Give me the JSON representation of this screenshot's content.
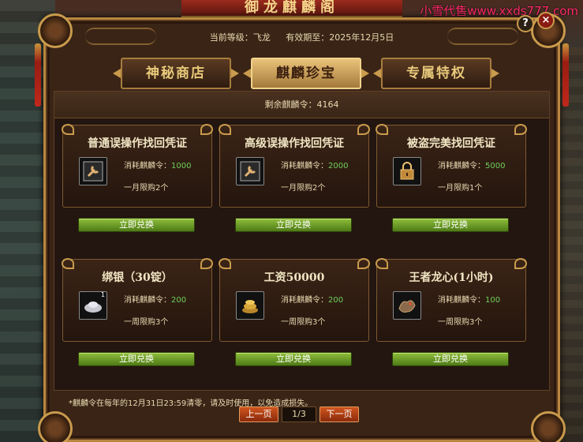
{
  "watermark": "小雪代售www.xxds777.com",
  "title": "御龙麒麟阁",
  "header": {
    "level": "当前等级：飞龙",
    "expiry": "有效期至：2025年12月5日",
    "help_label": "?",
    "close_label": "×"
  },
  "tabs": [
    {
      "label": "神秘商店",
      "active": false
    },
    {
      "label": "麒麟珍宝",
      "active": true
    },
    {
      "label": "专属特权",
      "active": false
    }
  ],
  "remaining": "剩余麒麟令：4164",
  "items": [
    {
      "title": "普通误操作找回凭证",
      "icon": "wrench-icon",
      "cost_label": "消耗麒麟令：",
      "cost": "1000",
      "limit": "一月限购2个",
      "count": "",
      "button": "立即兑换"
    },
    {
      "title": "高级误操作找回凭证",
      "icon": "wrench-icon",
      "cost_label": "消耗麒麟令：",
      "cost": "2000",
      "limit": "一月限购2个",
      "count": "",
      "button": "立即兑换"
    },
    {
      "title": "被盗完美找回凭证",
      "icon": "lock-icon",
      "cost_label": "消耗麒麟令：",
      "cost": "5000",
      "limit": "一月限购1个",
      "count": "",
      "button": "立即兑换"
    },
    {
      "title": "绑银（30锭）",
      "icon": "silver-ingot-icon",
      "cost_label": "消耗麒麟令：",
      "cost": "200",
      "limit": "一周限购3个",
      "count": "1",
      "button": "立即兑换"
    },
    {
      "title": "工资50000",
      "icon": "gold-coins-icon",
      "cost_label": "消耗麒麟令：",
      "cost": "200",
      "limit": "一周限购3个",
      "count": "",
      "button": "立即兑换"
    },
    {
      "title": "王者龙心(1小时)",
      "icon": "dragon-heart-icon",
      "cost_label": "消耗麒麟令：",
      "cost": "100",
      "limit": "一周限购3个",
      "count": "",
      "button": "立即兑换"
    }
  ],
  "notice": "*麒麟令在每年的12月31日23:59清零，请及时使用，以免造成损失。",
  "pager": {
    "prev": "上一页",
    "page": "1/3",
    "next": "下一页"
  },
  "colors": {
    "accent_gold": "#c99b4c",
    "cost_green": "#6fd15a",
    "button_green": "#6a9c26",
    "watermark_pink": "#ff2a6a"
  }
}
